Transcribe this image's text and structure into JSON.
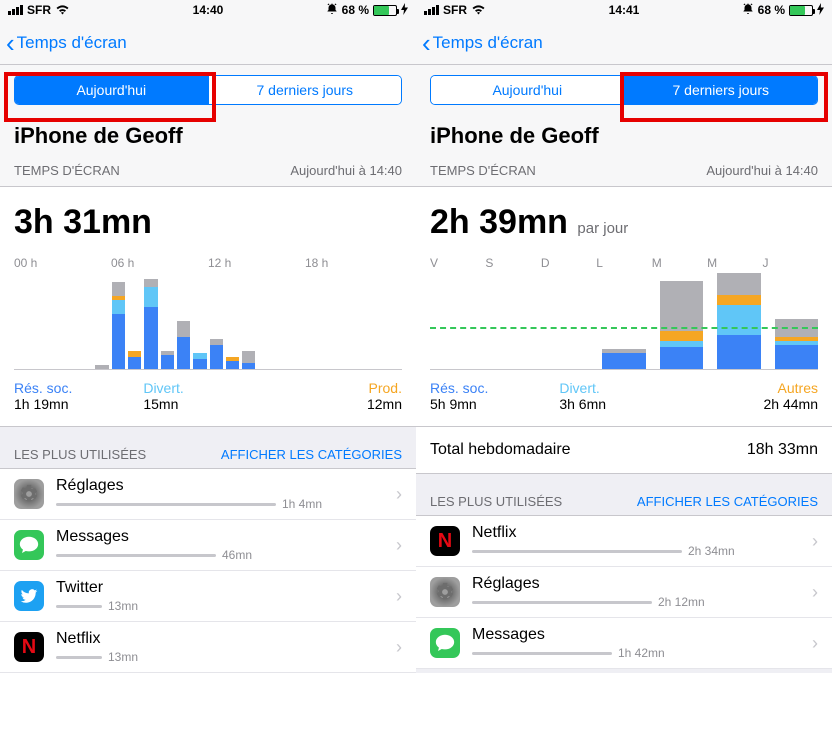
{
  "left": {
    "status": {
      "carrier": "SFR",
      "time": "14:40",
      "battery": "68 %"
    },
    "nav_back": "Temps d'écran",
    "seg": {
      "today": "Aujourd'hui",
      "week": "7 derniers jours",
      "active": "today"
    },
    "device": "iPhone de Geoff",
    "section_label": "TEMPS D'ÉCRAN",
    "section_time": "Aujourd'hui à 14:40",
    "total": "3h 31mn",
    "chart_data": {
      "type": "bar",
      "axis_labels": [
        "00 h",
        "06 h",
        "12 h",
        "18 h"
      ],
      "series_keys": [
        "soc",
        "div",
        "prod",
        "oth"
      ],
      "bars": [
        {
          "soc": 0,
          "div": 0,
          "prod": 0,
          "oth": 0
        },
        {
          "soc": 0,
          "div": 0,
          "prod": 0,
          "oth": 0
        },
        {
          "soc": 0,
          "div": 0,
          "prod": 0,
          "oth": 0
        },
        {
          "soc": 0,
          "div": 0,
          "prod": 0,
          "oth": 0
        },
        {
          "soc": 0,
          "div": 0,
          "prod": 0,
          "oth": 0
        },
        {
          "soc": 0,
          "div": 0,
          "prod": 0,
          "oth": 4
        },
        {
          "soc": 55,
          "div": 14,
          "prod": 4,
          "oth": 14
        },
        {
          "soc": 12,
          "div": 0,
          "prod": 6,
          "oth": 0
        },
        {
          "soc": 62,
          "div": 20,
          "prod": 0,
          "oth": 8
        },
        {
          "soc": 14,
          "div": 0,
          "prod": 0,
          "oth": 4
        },
        {
          "soc": 32,
          "div": 0,
          "prod": 0,
          "oth": 16
        },
        {
          "soc": 10,
          "div": 6,
          "prod": 0,
          "oth": 0
        },
        {
          "soc": 24,
          "div": 0,
          "prod": 0,
          "oth": 6
        },
        {
          "soc": 8,
          "div": 0,
          "prod": 4,
          "oth": 0
        },
        {
          "soc": 6,
          "div": 0,
          "prod": 0,
          "oth": 12
        },
        {
          "soc": 0,
          "div": 0,
          "prod": 0,
          "oth": 0
        },
        {
          "soc": 0,
          "div": 0,
          "prod": 0,
          "oth": 0
        },
        {
          "soc": 0,
          "div": 0,
          "prod": 0,
          "oth": 0
        },
        {
          "soc": 0,
          "div": 0,
          "prod": 0,
          "oth": 0
        },
        {
          "soc": 0,
          "div": 0,
          "prod": 0,
          "oth": 0
        },
        {
          "soc": 0,
          "div": 0,
          "prod": 0,
          "oth": 0
        },
        {
          "soc": 0,
          "div": 0,
          "prod": 0,
          "oth": 0
        },
        {
          "soc": 0,
          "div": 0,
          "prod": 0,
          "oth": 0
        },
        {
          "soc": 0,
          "div": 0,
          "prod": 0,
          "oth": 0
        }
      ]
    },
    "legend": [
      {
        "cls": "soc",
        "label": "Rés. soc.",
        "value": "1h 19mn"
      },
      {
        "cls": "div",
        "label": "Divert.",
        "value": "15mn"
      },
      {
        "cls": "prod",
        "label": "Prod.",
        "value": "12mn"
      }
    ],
    "most_used_title": "LES PLUS UTILISÉES",
    "show_cat": "AFFICHER LES CATÉGORIES",
    "apps": [
      {
        "name": "Réglages",
        "dur": "1h 4mn",
        "bar": 220,
        "icon": "settings"
      },
      {
        "name": "Messages",
        "dur": "46mn",
        "bar": 160,
        "icon": "messages"
      },
      {
        "name": "Twitter",
        "dur": "13mn",
        "bar": 46,
        "icon": "twitter"
      },
      {
        "name": "Netflix",
        "dur": "13mn",
        "bar": 46,
        "icon": "netflix"
      }
    ]
  },
  "right": {
    "status": {
      "carrier": "SFR",
      "time": "14:41",
      "battery": "68 %"
    },
    "nav_back": "Temps d'écran",
    "seg": {
      "today": "Aujourd'hui",
      "week": "7 derniers jours",
      "active": "week"
    },
    "device": "iPhone de Geoff",
    "section_label": "TEMPS D'ÉCRAN",
    "section_time": "Aujourd'hui à 14:40",
    "total": "2h 39mn",
    "total_sub": "par jour",
    "chart_data": {
      "type": "bar",
      "axis_labels": [
        "V",
        "S",
        "D",
        "L",
        "M",
        "M",
        "J"
      ],
      "avg_pct": 40,
      "series_keys": [
        "soc",
        "div",
        "prod",
        "oth"
      ],
      "bars": [
        {
          "soc": 0,
          "div": 0,
          "prod": 0,
          "oth": 0
        },
        {
          "soc": 0,
          "div": 0,
          "prod": 0,
          "oth": 0
        },
        {
          "soc": 0,
          "div": 0,
          "prod": 0,
          "oth": 0
        },
        {
          "soc": 16,
          "div": 0,
          "prod": 0,
          "oth": 4
        },
        {
          "soc": 22,
          "div": 6,
          "prod": 10,
          "oth": 50
        },
        {
          "soc": 34,
          "div": 30,
          "prod": 10,
          "oth": 22
        },
        {
          "soc": 24,
          "div": 4,
          "prod": 4,
          "oth": 18
        }
      ]
    },
    "legend": [
      {
        "cls": "soc",
        "label": "Rés. soc.",
        "value": "5h 9mn"
      },
      {
        "cls": "div",
        "label": "Divert.",
        "value": "3h 6mn"
      },
      {
        "cls": "autres",
        "label": "Autres",
        "value": "2h 44mn"
      }
    ],
    "weekly_label": "Total hebdomadaire",
    "weekly_value": "18h 33mn",
    "most_used_title": "LES PLUS UTILISÉES",
    "show_cat": "AFFICHER LES CATÉGORIES",
    "apps": [
      {
        "name": "Netflix",
        "dur": "2h 34mn",
        "bar": 210,
        "icon": "netflix"
      },
      {
        "name": "Réglages",
        "dur": "2h 12mn",
        "bar": 180,
        "icon": "settings"
      },
      {
        "name": "Messages",
        "dur": "1h 42mn",
        "bar": 140,
        "icon": "messages"
      }
    ]
  }
}
